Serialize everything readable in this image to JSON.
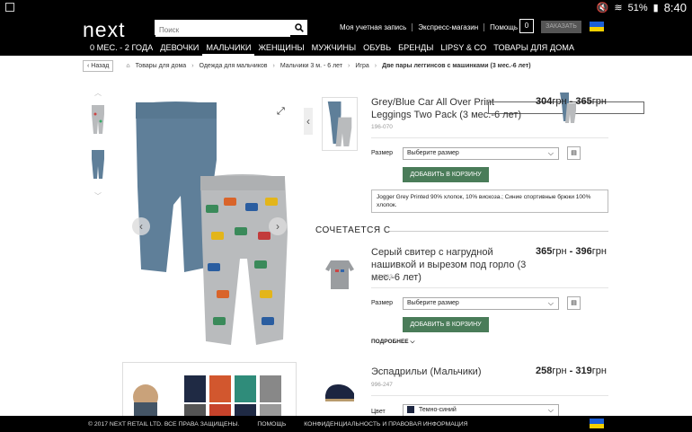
{
  "status_bar": {
    "battery": "51%",
    "time": "8:40"
  },
  "header": {
    "logo": "next",
    "search_placeholder": "Поиск",
    "links": [
      "Моя учетная запись",
      "Экспресс-магазин",
      "Помощь"
    ],
    "cart_count": "0",
    "order_label": "ЗАКАЗАТЬ"
  },
  "nav": [
    "0 МЕС. - 2 ГОДА",
    "ДЕВОЧКИ",
    "МАЛЬЧИКИ",
    "ЖЕНЩИНЫ",
    "МУЖЧИНЫ",
    "ОБУВЬ",
    "БРЕНДЫ",
    "LIPSY & CO",
    "ТОВАРЫ ДЛЯ ДОМА"
  ],
  "breadcrumb": {
    "back": "Назад",
    "items": [
      "Товары для дома",
      "Одежда для мальчиков",
      "Мальчики 3 м. - 6 лет",
      "Игра"
    ],
    "current": "Две пары леггинсов с машинками (3 мес.-6 лет)"
  },
  "product": {
    "title": "Grey/Blue Car All Over Print Leggings Two Pack (3 мес.-6 лет)",
    "price_from": "304",
    "price_to": "365",
    "currency": "грн",
    "code": "196-070",
    "size_label": "Размер",
    "size_placeholder": "Выберите размер",
    "add_to_cart": "ДОБАВИТЬ В КОРЗИНУ",
    "description": "Jogger Grey Printed 90% хлопок, 10% вискоза.; Синие спортивные брюки 100% хлопок."
  },
  "goes_with": {
    "heading": "СОЧЕТАЕТСЯ С",
    "items": [
      {
        "title": "Серый свитер с нагрудной нашивкой и вырезом под горло (3 мес.-6 лет)",
        "price_from": "365",
        "price_to": "396",
        "currency": "грн",
        "code": "163-963",
        "size_label": "Размер",
        "size_placeholder": "Выберите размер",
        "add_to_cart": "ДОБАВИТЬ В КОРЗИНУ",
        "more": "ПОДРОБНЕЕ"
      },
      {
        "title": "Эспадрильи (Мальчики)",
        "price_from": "258",
        "price_to": "319",
        "currency": "грн",
        "code": "996-247",
        "color_label": "Цвет",
        "color_value": "Темно-синий"
      }
    ]
  },
  "footer": {
    "copyright": "© 2017 NEXT RETAIL LTD. ВСЕ ПРАВА ЗАЩИЩЕНЫ.",
    "help": "ПОМОЩЬ",
    "privacy": "КОНФИДЕНЦИАЛЬНОСТЬ И ПРАВОВАЯ ИНФОРМАЦИЯ"
  },
  "colors": {
    "accent_green": "#4a7c59",
    "header_bg": "#000000",
    "leggings_blue": "#5f7f99",
    "leggings_grey": "#b9bbbd"
  }
}
